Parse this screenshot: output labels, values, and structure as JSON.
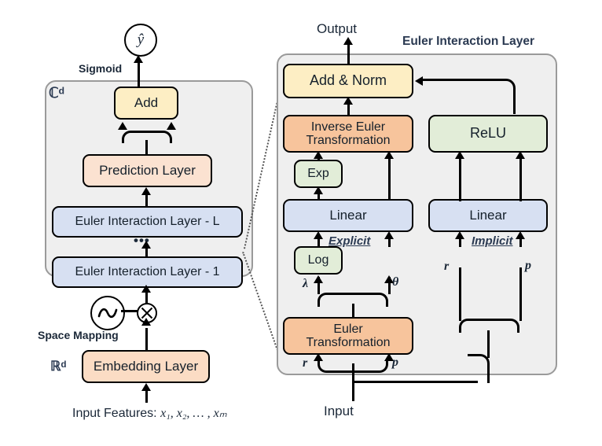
{
  "figure": {
    "title_right": "Euler Interaction Layer"
  },
  "left_panel": {
    "space_label": "ℂᵈ",
    "real_space_label": "ℝᵈ",
    "output_node": "ŷ",
    "sigmoid_label": "Sigmoid",
    "space_mapping_label": "Space Mapping",
    "input_features_label": "Input Features:",
    "input_features_vars": "x₁, x₂, … , xₘ",
    "ellipsis": "•••",
    "boxes": [
      {
        "label": "Add",
        "color": "#fdeec4"
      },
      {
        "label": "Prediction Layer",
        "color": "#fbe2d1"
      },
      {
        "label": "Euler Interaction Layer - L",
        "color": "#d7e0f2"
      },
      {
        "label": "Euler Interaction Layer - 1",
        "color": "#d7e0f2"
      },
      {
        "label": "Embedding Layer",
        "color": "#fbdcc4"
      }
    ]
  },
  "right_panel": {
    "output_label": "Output",
    "input_label": "Input",
    "branch_labels": {
      "explicit": "Explicit",
      "implicit": "Implicit"
    },
    "signal_labels": {
      "lambda": "λ",
      "theta": "θ",
      "r_left": "r",
      "p_left": "p",
      "r_right": "r",
      "p_right": "p"
    },
    "boxes": [
      {
        "label": "Add & Norm",
        "color": "#fdeec4"
      },
      {
        "label_line1": "Inverse Euler",
        "label_line2": "Transformation",
        "color": "#f7c49c"
      },
      {
        "label": "ReLU",
        "color": "#e2edd8"
      },
      {
        "label": "Exp",
        "color": "#e2edd8"
      },
      {
        "label": "Linear",
        "color": "#d7e0f2"
      },
      {
        "label": "Linear",
        "color": "#d7e0f2"
      },
      {
        "label": "Log",
        "color": "#e2edd8"
      },
      {
        "label_line1": "Euler",
        "label_line2": "Transformation",
        "color": "#f7c49c"
      }
    ]
  },
  "colors": {
    "yellow": "#fdeec4",
    "peach_light": "#fbe2d1",
    "peach": "#fbdcc4",
    "salmon": "#f7c49c",
    "blue": "#d7e0f2",
    "green": "#e2edd8",
    "panel_bg": "#efefef",
    "panel_border": "#9a9a9a",
    "ink": "#15202b"
  }
}
